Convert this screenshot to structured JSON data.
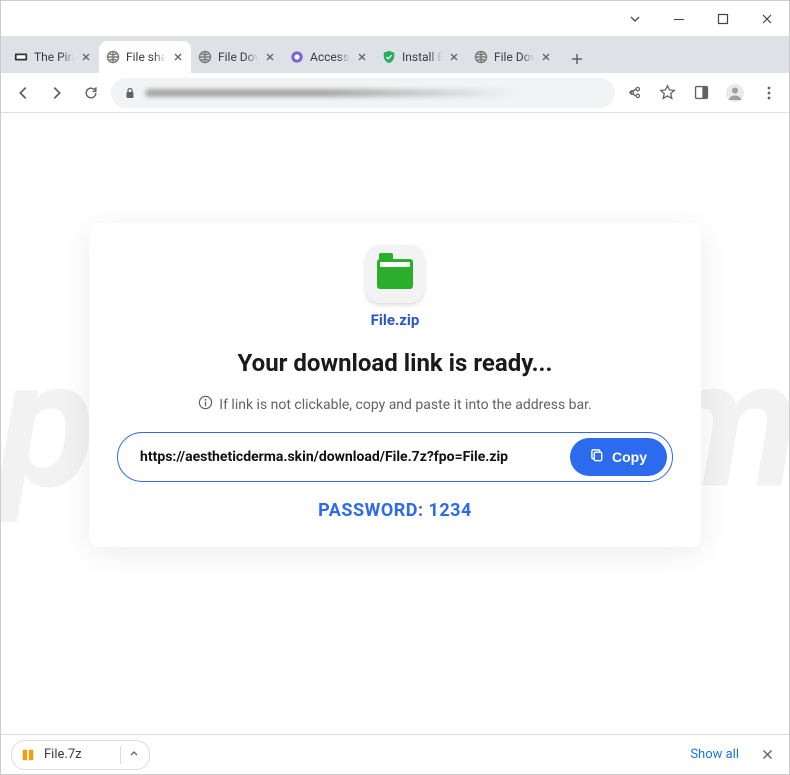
{
  "tabs": [
    {
      "title": "The Pirate"
    },
    {
      "title": "File sharing"
    },
    {
      "title": "File Download"
    },
    {
      "title": "Access po"
    },
    {
      "title": "Install Ext"
    },
    {
      "title": "File Download"
    }
  ],
  "card": {
    "file_name": "File.zip",
    "headline": "Your download link is ready...",
    "hint": "If link is not clickable, copy and paste it into the address bar.",
    "link": "https://aestheticderma.skin/download/File.7z?fpo=File.zip",
    "copy_label": "Copy",
    "password_label": "PASSWORD:",
    "password_value": "1234"
  },
  "download_shelf": {
    "item": "File.7z",
    "show_all": "Show all"
  },
  "watermark": "pcrisk.com"
}
